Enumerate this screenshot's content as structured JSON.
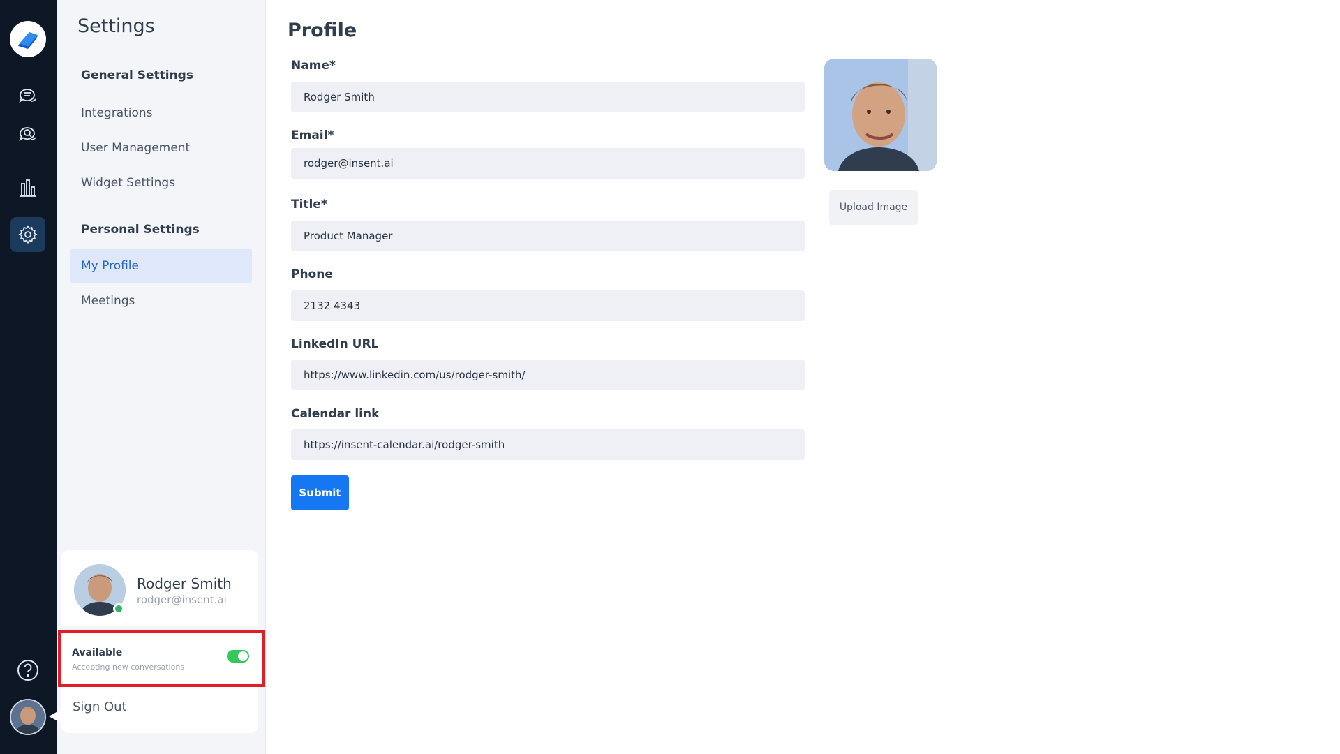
{
  "sidebar": {
    "title": "Settings",
    "groups": [
      {
        "label": "General Settings"
      },
      {
        "label": "Personal Settings"
      }
    ],
    "items": [
      {
        "label": "Integrations"
      },
      {
        "label": "User Management"
      },
      {
        "label": "Widget Settings"
      },
      {
        "label": "My Profile"
      },
      {
        "label": "Meetings"
      }
    ]
  },
  "rail": {
    "icons": [
      "logo-icon",
      "conversations-icon",
      "search-conversations-icon",
      "analytics-icon",
      "settings-icon",
      "help-icon",
      "user-avatar"
    ]
  },
  "user": {
    "name": "Rodger Smith",
    "email": "rodger@insent.ai"
  },
  "availability": {
    "label": "Available",
    "sublabel": "Accepting new conversations",
    "enabled": true
  },
  "signout": {
    "label": "Sign Out"
  },
  "profile": {
    "title": "Profile",
    "fields": [
      {
        "label": "Name*",
        "value": "Rodger Smith"
      },
      {
        "label": "Email*",
        "value": "rodger@insent.ai"
      },
      {
        "label": "Title*",
        "value": "Product Manager"
      },
      {
        "label": "Phone",
        "value": "2132 4343"
      },
      {
        "label": "LinkedIn URL",
        "value": "https://www.linkedin.com/us/rodger-smith/"
      },
      {
        "label": "Calendar link",
        "value": "https://insent-calendar.ai/rodger-smith"
      }
    ],
    "submit_label": "Submit",
    "upload_label": "Upload Image"
  },
  "colors": {
    "rail_bg": "#0d1726",
    "accent": "#1578f2",
    "active_item_bg": "#dfe8fb",
    "highlight_border": "#e01e26",
    "online": "#2fb665"
  }
}
